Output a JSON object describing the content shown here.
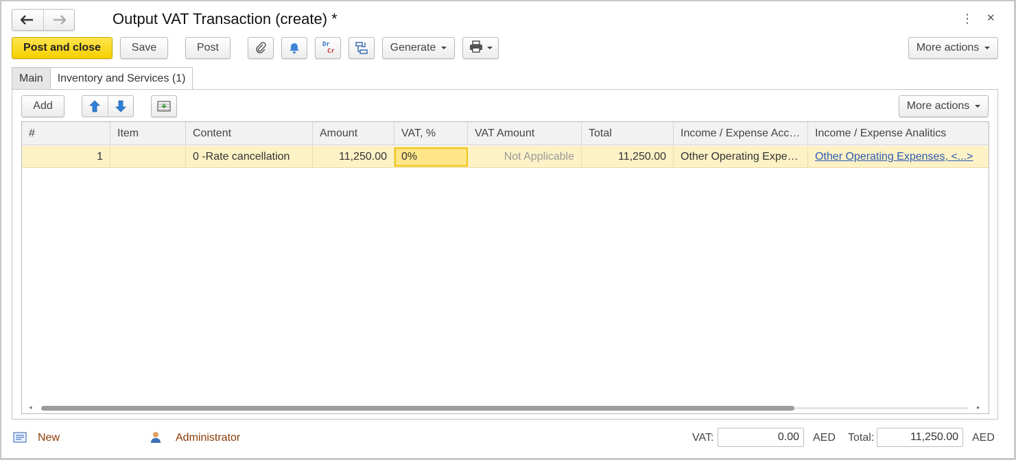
{
  "window": {
    "title": "Output VAT Transaction (create) *",
    "more_icon": "vertical-ellipsis-icon",
    "close_icon": "close-icon",
    "more_glyph": "⋮",
    "close_glyph": "✕"
  },
  "nav": {
    "back_glyph": "🡐",
    "forward_glyph": "🡒"
  },
  "toolbar": {
    "post_and_close": "Post and close",
    "save": "Save",
    "post": "Post",
    "dr": "Dr",
    "cr": "Cr",
    "generate": "Generate",
    "more_actions": "More actions"
  },
  "tabs": [
    {
      "label": "Main"
    },
    {
      "label": "Inventory and Services (1)"
    }
  ],
  "table_toolbar": {
    "add": "Add",
    "more_actions": "More actions"
  },
  "columns": [
    {
      "label": "#"
    },
    {
      "label": "Item"
    },
    {
      "label": "Content"
    },
    {
      "label": "Amount"
    },
    {
      "label": "VAT, %"
    },
    {
      "label": "VAT Amount"
    },
    {
      "label": "Total"
    },
    {
      "label": "Income / Expense Acco..."
    },
    {
      "label": "Income / Expense Analitics"
    }
  ],
  "rows": [
    {
      "num": "1",
      "item": "",
      "content": "0 -Rate cancellation",
      "amount": "11,250.00",
      "vat_rate": "0%",
      "vat_amount": "Not Applicable",
      "total": "11,250.00",
      "account": "Other Operating Expen...",
      "analytics": "Other Operating Expenses, <...>"
    }
  ],
  "footer": {
    "status": "New",
    "author": "Administrator",
    "vat_label": "VAT:",
    "vat_value": "0.00",
    "vat_currency": "AED",
    "total_label": "Total:",
    "total_value": "11,250.00",
    "total_currency": "AED"
  },
  "colors": {
    "accent": "#f5d000",
    "row_highlight": "#fdf2c6",
    "link": "#2b5bb3",
    "footer_link": "#8a3a00",
    "arrow_blue": "#2f7fd8"
  }
}
